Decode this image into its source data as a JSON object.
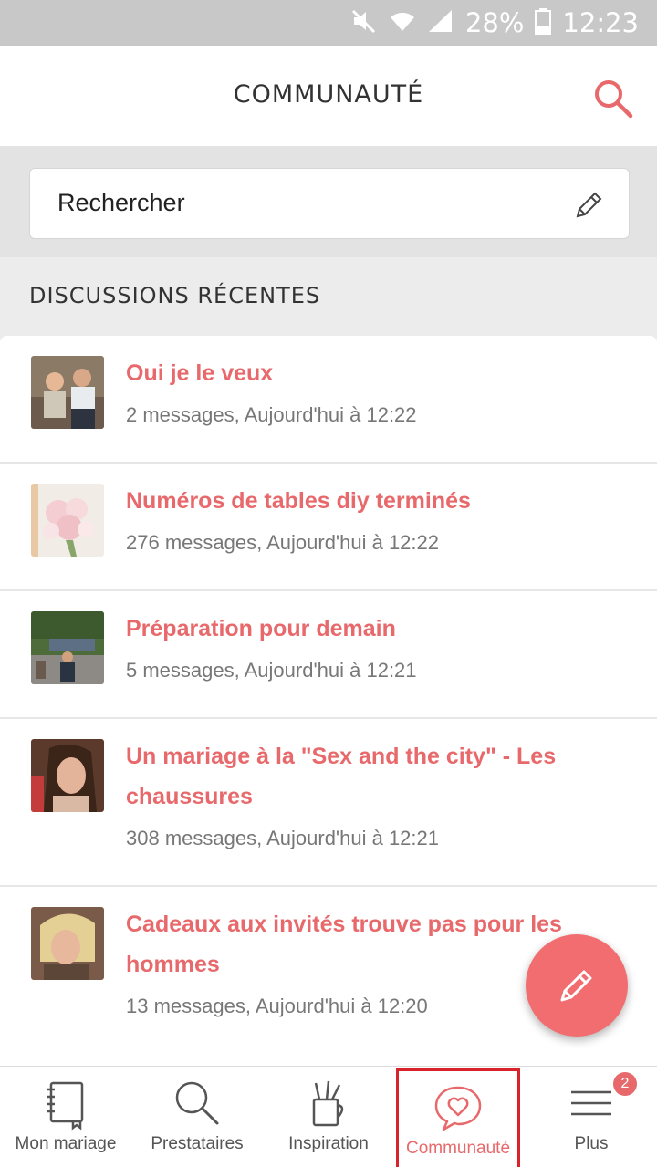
{
  "status_bar": {
    "battery": "28%",
    "time": "12:23"
  },
  "header": {
    "title": "COMMUNAUTÉ"
  },
  "search": {
    "placeholder": "Rechercher"
  },
  "section": {
    "title": "DISCUSSIONS RÉCENTES"
  },
  "discussions": [
    {
      "title": "Oui je le veux",
      "meta": "2 messages, Aujourd'hui à 12:22"
    },
    {
      "title": "Numéros de tables diy terminés",
      "meta": "276 messages, Aujourd'hui à 12:22"
    },
    {
      "title": "Préparation pour demain",
      "meta": "5 messages, Aujourd'hui à 12:21"
    },
    {
      "title": "Un mariage à la \"Sex and the city\" - Les chaussures",
      "meta": "308 messages, Aujourd'hui à 12:21"
    },
    {
      "title": "Cadeaux aux invités trouve pas pour les hommes",
      "meta": "13 messages, Aujourd'hui à 12:20"
    }
  ],
  "nav": {
    "items": [
      {
        "label": "Mon mariage",
        "icon": "notebook-icon"
      },
      {
        "label": "Prestataires",
        "icon": "search-icon"
      },
      {
        "label": "Inspiration",
        "icon": "pencil-cup-icon"
      },
      {
        "label": "Communauté",
        "icon": "chat-heart-icon"
      },
      {
        "label": "Plus",
        "icon": "menu-icon"
      }
    ],
    "active": "Communauté",
    "badge": "2"
  },
  "colors": {
    "accent": "#e8696b",
    "fab": "#f26d6f",
    "highlight": "#d9232a"
  }
}
